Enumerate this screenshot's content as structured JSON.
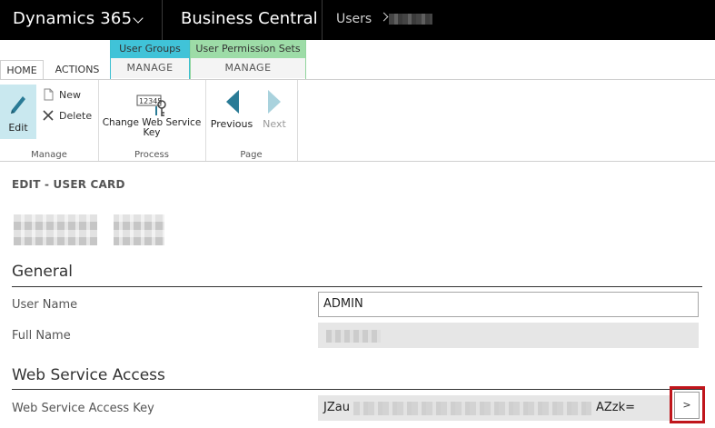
{
  "topbar": {
    "app_title": "Dynamics 365",
    "product_title": "Business Central",
    "breadcrumb_root": "Users"
  },
  "ribbon_tabs": {
    "home": "HOME",
    "actions": "ACTIONS",
    "user_groups_head": "User Groups",
    "user_groups_tab": "MANAGE",
    "user_perm_sets_head": "User Permission Sets",
    "user_perm_sets_tab": "MANAGE"
  },
  "ribbon": {
    "manage_group": "Manage",
    "edit": "Edit",
    "new": "New",
    "delete": "Delete",
    "process_group": "Process",
    "change_ws_key_line1": "Change Web Service",
    "change_ws_key_line2": "Key",
    "key_icon_text": "12345",
    "page_group": "Page",
    "previous": "Previous",
    "next": "Next"
  },
  "page": {
    "caption": "EDIT - USER CARD",
    "general_section": "General",
    "user_name_label": "User Name",
    "user_name_value": "ADMIN",
    "full_name_label": "Full Name",
    "ws_section": "Web Service Access",
    "ws_key_label": "Web Service Access Key",
    "ws_key_prefix": "JZau",
    "ws_key_suffix": "AZzk=",
    "assist_button": ">"
  },
  "colors": {
    "topbar": "#000000",
    "user_groups_accent": "#40c3d8",
    "perm_sets_accent": "#9ddca7",
    "edit_highlight": "#c9e8ef",
    "nav_arrow": "#2a7b96",
    "annotation_box": "#c0151b"
  },
  "icons": [
    "chevron-down-icon",
    "edit-pencil-icon",
    "new-document-icon",
    "delete-x-icon",
    "key-icon",
    "previous-arrow-icon",
    "next-arrow-icon"
  ]
}
